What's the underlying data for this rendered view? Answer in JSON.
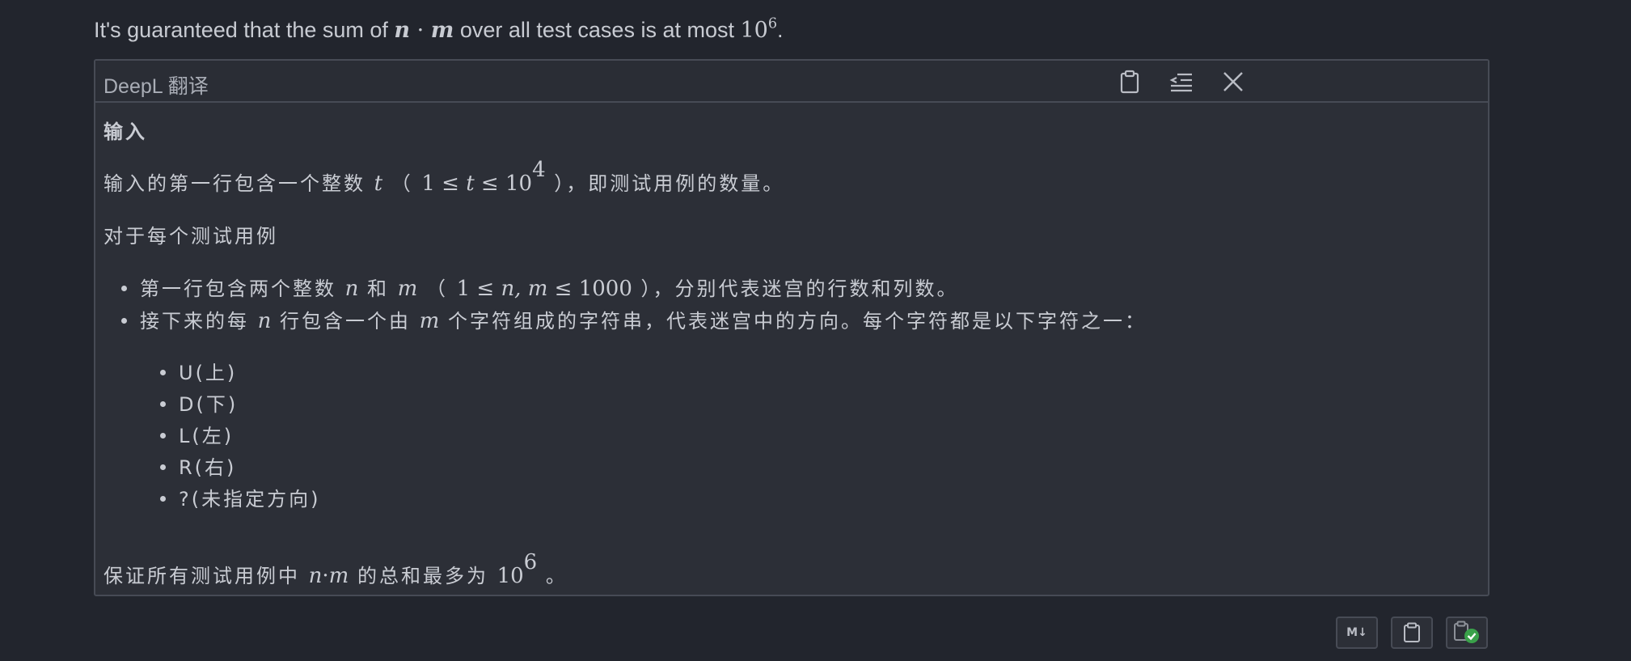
{
  "top_line": {
    "prefix": "It's guaranteed that the sum of ",
    "expr_n": "n",
    "expr_dot": " · ",
    "expr_m": "m",
    "middle": " over all test cases is at most ",
    "base": "10",
    "exp": "6",
    "suffix": "."
  },
  "panel": {
    "title": "DeepL 翻译",
    "copy_icon": "clipboard-icon",
    "indent_icon": "outdent-icon",
    "close_icon": "close-icon"
  },
  "content": {
    "heading": "输入",
    "p1": {
      "a": "输入的第一行包含一个整数 ",
      "var_t": "t",
      "b": " （ ",
      "math_1": "1 ≤ ",
      "math_t": "t",
      "math_2": " ≤ 10",
      "math_exp": "4",
      "c": " ），即测试用例的数量。"
    },
    "p2": "对于每个测试用例",
    "bullets": [
      {
        "a": "第一行包含两个整数 ",
        "var1": "n",
        "b": " 和 ",
        "var2": "m",
        "c": " （ ",
        "math_1": "1 ≤ ",
        "math_v": "n, m",
        "math_2": " ≤ 1000",
        "d": " ），分别代表迷宫的行数和列数。"
      },
      {
        "a": "接下来的每 ",
        "var1": "n",
        "b": " 行包含一个由 ",
        "var2": "m",
        "c": " 个字符组成的字符串，代表迷宫中的方向。每个字符都是以下字符之一："
      }
    ],
    "sub_bullets": [
      "U(上)",
      "D(下)",
      "L(左)",
      "R(右)",
      "?(未指定方向)"
    ],
    "p3": {
      "a": "保证所有测试用例中 ",
      "var_n": "n",
      "dot": "·",
      "var_m": "m",
      "b": " 的总和最多为 ",
      "base": "10",
      "exp": "6",
      "c": " 。"
    }
  },
  "footer": {
    "markdown_label": "M↓",
    "markdown_icon": "markdown-icon",
    "copy_icon": "clipboard-icon",
    "check_icon": "copy-check-icon"
  },
  "colors": {
    "background": "#22252d",
    "panel": "#2c2f37",
    "border": "#474b55",
    "text": "#c9ccd3",
    "check_green": "#3aa14a"
  }
}
